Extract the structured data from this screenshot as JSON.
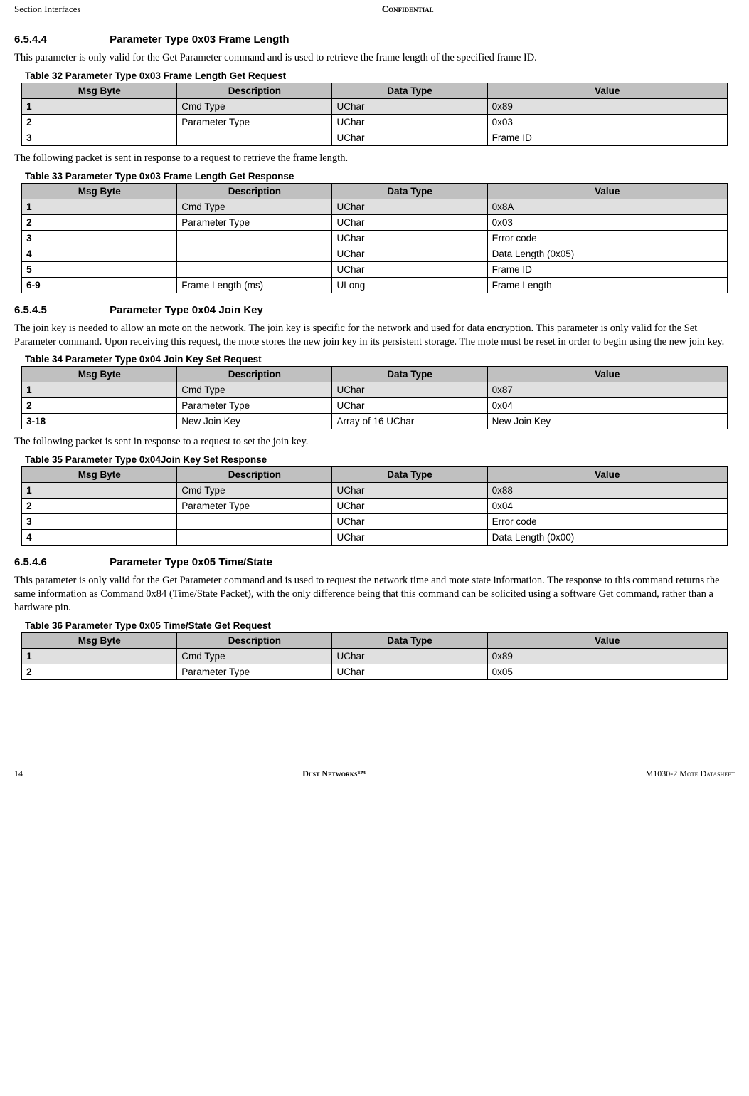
{
  "header": {
    "left": "Section Interfaces",
    "center": "Confidential"
  },
  "sections": {
    "s1": {
      "num": "6.5.4.4",
      "title": "Parameter Type 0x03 Frame Length",
      "body1": "This parameter is only valid for the Get Parameter command and is used to retrieve the frame length of the specified frame ID.",
      "body2": "The following packet is sent in response to a request to retrieve the frame length."
    },
    "s2": {
      "num": "6.5.4.5",
      "title": "Parameter Type 0x04 Join Key",
      "body1": "The join key is needed to allow an mote on the network. The join key is specific for the network and used for data encryption. This parameter is only valid for the Set Parameter command. Upon receiving this request, the mote stores the new join key in its persistent storage. The mote must be reset in order to begin using the new join key.",
      "body2": "The following packet is sent in response to a request to set the join key."
    },
    "s3": {
      "num": "6.5.4.6",
      "title": "Parameter Type 0x05 Time/State",
      "body1": "This parameter is only valid for the Get Parameter command and is used to request the network time and mote state information. The response to this command returns the same information as Command 0x84 (Time/State Packet), with the only difference being that this command can be solicited using a software Get command, rather than a hardware pin."
    }
  },
  "cols": {
    "c1": "Msg Byte",
    "c2": "Description",
    "c3": "Data Type",
    "c4": "Value"
  },
  "tables": {
    "t32": {
      "caption": "Table 32   Parameter Type 0x03 Frame Length Get Request",
      "rows": [
        {
          "b": "1",
          "d": "Cmd Type",
          "t": "UChar",
          "v": "0x89",
          "shaded": true
        },
        {
          "b": "2",
          "d": "Parameter Type",
          "t": "UChar",
          "v": "0x03"
        },
        {
          "b": "3",
          "d": "",
          "t": "UChar",
          "v": "Frame ID"
        }
      ]
    },
    "t33": {
      "caption": "Table 33   Parameter Type 0x03 Frame Length Get Response",
      "rows": [
        {
          "b": "1",
          "d": "Cmd Type",
          "t": "UChar",
          "v": "0x8A",
          "shaded": true
        },
        {
          "b": "2",
          "d": "Parameter Type",
          "t": "UChar",
          "v": "0x03"
        },
        {
          "b": "3",
          "d": "",
          "t": "UChar",
          "v": "Error code"
        },
        {
          "b": "4",
          "d": "",
          "t": "UChar",
          "v": "Data Length (0x05)"
        },
        {
          "b": "5",
          "d": "",
          "t": "UChar",
          "v": "Frame ID"
        },
        {
          "b": "6-9",
          "d": "Frame Length (ms)",
          "t": "ULong",
          "v": "Frame Length"
        }
      ]
    },
    "t34": {
      "caption": "Table 34   Parameter Type 0x04 Join Key Set Request",
      "rows": [
        {
          "b": "1",
          "d": "Cmd Type",
          "t": "UChar",
          "v": "0x87",
          "shaded": true
        },
        {
          "b": "2",
          "d": "Parameter Type",
          "t": "UChar",
          "v": "0x04"
        },
        {
          "b": "3-18",
          "d": "New Join Key",
          "t": "Array of 16 UChar",
          "v": "New Join Key"
        }
      ]
    },
    "t35": {
      "caption": "Table 35   Parameter Type 0x04Join Key Set Response",
      "rows": [
        {
          "b": "1",
          "d": "Cmd Type",
          "t": "UChar",
          "v": "0x88",
          "shaded": true
        },
        {
          "b": "2",
          "d": "Parameter Type",
          "t": "UChar",
          "v": "0x04"
        },
        {
          "b": "3",
          "d": "",
          "t": "UChar",
          "v": "Error code"
        },
        {
          "b": "4",
          "d": "",
          "t": "UChar",
          "v": "Data Length (0x00)"
        }
      ]
    },
    "t36": {
      "caption": "Table 36   Parameter Type 0x05 Time/State Get Request",
      "rows": [
        {
          "b": "1",
          "d": "Cmd Type",
          "t": "UChar",
          "v": "0x89",
          "shaded": true
        },
        {
          "b": "2",
          "d": "Parameter Type",
          "t": "UChar",
          "v": "0x05"
        }
      ]
    }
  },
  "footer": {
    "left": "14",
    "center": "Dust Networks™",
    "right": "M1030-2 Mote Datasheet"
  }
}
